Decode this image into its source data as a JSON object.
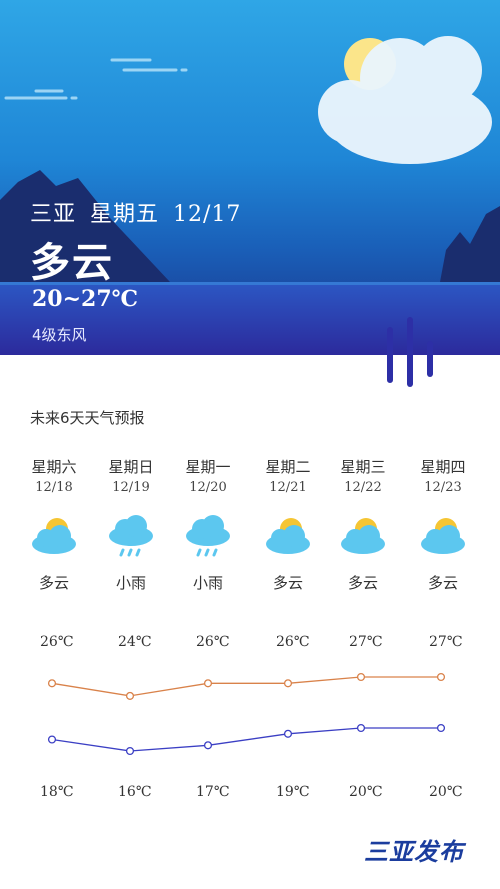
{
  "header": {
    "city": "三亚",
    "weekday": "星期五",
    "date": "12/17",
    "condition": "多云",
    "temp_range": "20~27℃",
    "wind": "4级东风"
  },
  "forecast": {
    "title": "未来6天天气预报",
    "days": [
      {
        "weekday": "星期六",
        "date": "12/18",
        "icon": "partly-cloudy-icon",
        "condition": "多云",
        "high": "26℃",
        "low": "18℃"
      },
      {
        "weekday": "星期日",
        "date": "12/19",
        "icon": "light-rain-icon",
        "condition": "小雨",
        "high": "24℃",
        "low": "16℃"
      },
      {
        "weekday": "星期一",
        "date": "12/20",
        "icon": "light-rain-icon",
        "condition": "小雨",
        "high": "26℃",
        "low": "17℃"
      },
      {
        "weekday": "星期二",
        "date": "12/21",
        "icon": "partly-cloudy-icon",
        "condition": "多云",
        "high": "26℃",
        "low": "19℃"
      },
      {
        "weekday": "星期三",
        "date": "12/22",
        "icon": "partly-cloudy-icon",
        "condition": "多云",
        "high": "27℃",
        "low": "20℃"
      },
      {
        "weekday": "星期四",
        "date": "12/23",
        "icon": "partly-cloudy-icon",
        "condition": "多云",
        "high": "27℃",
        "low": "20℃"
      }
    ]
  },
  "chart_data": {
    "type": "line",
    "categories": [
      "12/18",
      "12/19",
      "12/20",
      "12/21",
      "12/22",
      "12/23"
    ],
    "series": [
      {
        "values": [
          26,
          24,
          26,
          26,
          27,
          27
        ],
        "color": "#d9824a"
      },
      {
        "values": [
          18,
          16,
          17,
          19,
          20,
          20
        ],
        "color": "#3b3fc4"
      }
    ]
  },
  "colors": {
    "sky_top": "#2fa6e6",
    "sky_bottom": "#1c2f86",
    "high_line": "#d9824a",
    "low_line": "#3b3fc4",
    "logo": "#1b3d9e"
  },
  "logo": {
    "text": "三亚发布"
  }
}
